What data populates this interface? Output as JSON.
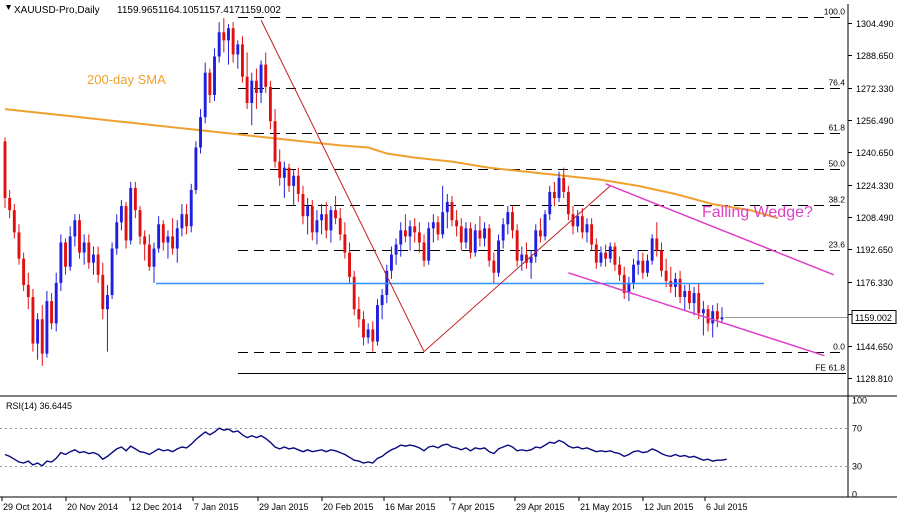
{
  "header": {
    "symbol": "XAUUSD-Pro,Daily",
    "open": "1159.965",
    "high": "1164.105",
    "low": "1157.417",
    "close": "1159.002"
  },
  "colors": {
    "bull": "#1f1fe0",
    "bear": "#e01010",
    "sma": "#f0a030",
    "wedge": "#e040c8",
    "support": "#3090ff",
    "fib": "#000000",
    "rsi": "#0a0a80",
    "zigzag": "#c02020"
  },
  "labels": {
    "sma": "200-day SMA",
    "pattern": "Falling Wedge?"
  },
  "price_axis": {
    "ticks": [
      "1304.490",
      "1288.650",
      "1272.330",
      "1256.490",
      "1240.650",
      "1224.330",
      "1208.490",
      "1192.650",
      "1176.330",
      "1160.490",
      "1144.650",
      "1128.810"
    ],
    "current": "1159.002"
  },
  "rsi": {
    "label": "RSI(14) 36.6445",
    "ticks": [
      "100",
      "70",
      "30",
      "0"
    ],
    "levels": [
      70,
      30
    ]
  },
  "x_axis": {
    "labels": [
      "29 Oct 2014",
      "20 Nov 2014",
      "12 Dec 2014",
      "7 Jan 2015",
      "29 Jan 2015",
      "20 Feb 2015",
      "16 Mar 2015",
      "7 Apr 2015",
      "29 Apr 2015",
      "21 May 2015",
      "12 Jun 2015",
      "6 Jul 2015"
    ]
  },
  "chart_data": {
    "type": "candlestick",
    "title": "XAUUSD-Pro,Daily",
    "ylim": [
      1124,
      1312
    ],
    "rsi_ylim": [
      0,
      100
    ],
    "fibonacci": [
      {
        "label": "100.0",
        "price": 1307.5
      },
      {
        "label": "76.4",
        "price": 1272.3
      },
      {
        "label": "61.8",
        "price": 1250.1
      },
      {
        "label": "50.0",
        "price": 1232.2
      },
      {
        "label": "38.2",
        "price": 1214.4
      },
      {
        "label": "23.6",
        "price": 1192.2
      },
      {
        "label": "0.0",
        "price": 1141.8
      },
      {
        "label": "FE 61.8",
        "price": 1131.5
      }
    ],
    "support_level": 1176.0,
    "sma_200": [
      [
        0,
        1262
      ],
      [
        8,
        1260
      ],
      [
        16,
        1258
      ],
      [
        24,
        1256
      ],
      [
        32,
        1254
      ],
      [
        40,
        1252
      ],
      [
        48,
        1250
      ],
      [
        56,
        1248
      ],
      [
        64,
        1246
      ],
      [
        72,
        1244
      ],
      [
        78,
        1243
      ],
      [
        82,
        1240
      ],
      [
        88,
        1238
      ],
      [
        96,
        1236
      ],
      [
        104,
        1233
      ],
      [
        112,
        1231
      ],
      [
        120,
        1229
      ],
      [
        128,
        1227
      ],
      [
        136,
        1224
      ],
      [
        144,
        1220
      ],
      [
        152,
        1215
      ],
      [
        160,
        1212
      ],
      [
        166,
        1208
      ]
    ],
    "wedge_upper": [
      [
        129,
        1225
      ],
      [
        178,
        1180
      ]
    ],
    "wedge_lower": [
      [
        121,
        1181
      ],
      [
        176,
        1140
      ]
    ],
    "zigzag": [
      [
        55,
        1306
      ],
      [
        90,
        1142
      ],
      [
        130,
        1224
      ]
    ],
    "ohlc": [
      [
        1246,
        1248,
        1213,
        1218
      ],
      [
        1218,
        1222,
        1208,
        1212
      ],
      [
        1212,
        1215,
        1198,
        1201
      ],
      [
        1201,
        1205,
        1185,
        1188
      ],
      [
        1188,
        1191,
        1172,
        1175
      ],
      [
        1175,
        1181,
        1163,
        1169
      ],
      [
        1169,
        1173,
        1142,
        1146
      ],
      [
        1146,
        1161,
        1138,
        1158
      ],
      [
        1158,
        1165,
        1135,
        1141
      ],
      [
        1141,
        1172,
        1139,
        1167
      ],
      [
        1167,
        1171,
        1153,
        1156
      ],
      [
        1156,
        1181,
        1152,
        1176
      ],
      [
        1176,
        1200,
        1172,
        1196
      ],
      [
        1196,
        1198,
        1180,
        1184
      ],
      [
        1184,
        1204,
        1182,
        1199
      ],
      [
        1199,
        1210,
        1194,
        1207
      ],
      [
        1207,
        1210,
        1188,
        1191
      ],
      [
        1191,
        1200,
        1185,
        1196
      ],
      [
        1196,
        1200,
        1183,
        1186
      ],
      [
        1186,
        1194,
        1180,
        1190
      ],
      [
        1190,
        1194,
        1176,
        1180
      ],
      [
        1180,
        1186,
        1158,
        1163
      ],
      [
        1163,
        1175,
        1142,
        1170
      ],
      [
        1170,
        1196,
        1168,
        1193
      ],
      [
        1193,
        1210,
        1190,
        1206
      ],
      [
        1206,
        1217,
        1202,
        1214
      ],
      [
        1214,
        1216,
        1193,
        1197
      ],
      [
        1197,
        1226,
        1195,
        1223
      ],
      [
        1223,
        1226,
        1208,
        1212
      ],
      [
        1212,
        1214,
        1195,
        1199
      ],
      [
        1199,
        1202,
        1187,
        1195
      ],
      [
        1195,
        1200,
        1182,
        1184
      ],
      [
        1184,
        1196,
        1176,
        1193
      ],
      [
        1193,
        1209,
        1191,
        1205
      ],
      [
        1205,
        1207,
        1192,
        1196
      ],
      [
        1196,
        1202,
        1188,
        1199
      ],
      [
        1199,
        1208,
        1190,
        1193
      ],
      [
        1193,
        1207,
        1186,
        1203
      ],
      [
        1203,
        1215,
        1199,
        1210
      ],
      [
        1210,
        1215,
        1200,
        1204
      ],
      [
        1204,
        1225,
        1201,
        1222
      ],
      [
        1222,
        1246,
        1220,
        1243
      ],
      [
        1243,
        1262,
        1240,
        1258
      ],
      [
        1258,
        1285,
        1255,
        1280
      ],
      [
        1280,
        1282,
        1265,
        1269
      ],
      [
        1269,
        1292,
        1266,
        1288
      ],
      [
        1288,
        1305,
        1285,
        1300
      ],
      [
        1300,
        1307,
        1290,
        1296
      ],
      [
        1296,
        1304,
        1284,
        1302
      ],
      [
        1302,
        1305,
        1285,
        1289
      ],
      [
        1289,
        1296,
        1282,
        1294
      ],
      [
        1294,
        1298,
        1275,
        1278
      ],
      [
        1278,
        1290,
        1262,
        1265
      ],
      [
        1265,
        1280,
        1254,
        1276
      ],
      [
        1276,
        1282,
        1262,
        1270
      ],
      [
        1270,
        1286,
        1265,
        1284
      ],
      [
        1284,
        1290,
        1270,
        1273
      ],
      [
        1273,
        1276,
        1252,
        1256
      ],
      [
        1256,
        1262,
        1233,
        1236
      ],
      [
        1236,
        1242,
        1224,
        1228
      ],
      [
        1228,
        1236,
        1218,
        1233
      ],
      [
        1233,
        1235,
        1221,
        1224
      ],
      [
        1224,
        1232,
        1214,
        1229
      ],
      [
        1229,
        1233,
        1216,
        1220
      ],
      [
        1220,
        1224,
        1205,
        1209
      ],
      [
        1209,
        1218,
        1200,
        1214
      ],
      [
        1214,
        1217,
        1197,
        1201
      ],
      [
        1201,
        1212,
        1195,
        1207
      ],
      [
        1207,
        1215,
        1200,
        1210
      ],
      [
        1210,
        1216,
        1198,
        1202
      ],
      [
        1202,
        1214,
        1196,
        1212
      ],
      [
        1212,
        1219,
        1205,
        1208
      ],
      [
        1208,
        1213,
        1197,
        1200
      ],
      [
        1200,
        1206,
        1188,
        1191
      ],
      [
        1191,
        1196,
        1176,
        1179
      ],
      [
        1179,
        1182,
        1160,
        1163
      ],
      [
        1163,
        1169,
        1154,
        1158
      ],
      [
        1158,
        1162,
        1145,
        1149
      ],
      [
        1149,
        1156,
        1146,
        1153
      ],
      [
        1153,
        1157,
        1142,
        1147
      ],
      [
        1147,
        1168,
        1145,
        1165
      ],
      [
        1165,
        1173,
        1158,
        1170
      ],
      [
        1170,
        1185,
        1166,
        1182
      ],
      [
        1182,
        1194,
        1178,
        1190
      ],
      [
        1190,
        1198,
        1185,
        1195
      ],
      [
        1195,
        1206,
        1189,
        1202
      ],
      [
        1202,
        1210,
        1196,
        1199
      ],
      [
        1199,
        1207,
        1192,
        1204
      ],
      [
        1204,
        1208,
        1196,
        1201
      ],
      [
        1201,
        1206,
        1191,
        1196
      ],
      [
        1196,
        1200,
        1184,
        1187
      ],
      [
        1187,
        1206,
        1185,
        1203
      ],
      [
        1203,
        1210,
        1196,
        1206
      ],
      [
        1206,
        1209,
        1197,
        1200
      ],
      [
        1200,
        1224,
        1198,
        1211
      ],
      [
        1211,
        1220,
        1203,
        1216
      ],
      [
        1216,
        1219,
        1204,
        1207
      ],
      [
        1207,
        1212,
        1199,
        1204
      ],
      [
        1204,
        1208,
        1192,
        1196
      ],
      [
        1196,
        1206,
        1193,
        1203
      ],
      [
        1203,
        1206,
        1188,
        1191
      ],
      [
        1191,
        1205,
        1189,
        1202
      ],
      [
        1202,
        1209,
        1194,
        1198
      ],
      [
        1198,
        1206,
        1194,
        1203
      ],
      [
        1203,
        1205,
        1184,
        1187
      ],
      [
        1187,
        1191,
        1176,
        1181
      ],
      [
        1181,
        1200,
        1179,
        1197
      ],
      [
        1197,
        1208,
        1193,
        1205
      ],
      [
        1205,
        1214,
        1200,
        1211
      ],
      [
        1211,
        1214,
        1198,
        1202
      ],
      [
        1202,
        1205,
        1184,
        1187
      ],
      [
        1187,
        1194,
        1182,
        1190
      ],
      [
        1190,
        1196,
        1183,
        1186
      ],
      [
        1186,
        1192,
        1178,
        1189
      ],
      [
        1189,
        1205,
        1186,
        1202
      ],
      [
        1202,
        1208,
        1196,
        1199
      ],
      [
        1199,
        1212,
        1197,
        1210
      ],
      [
        1210,
        1224,
        1207,
        1221
      ],
      [
        1221,
        1226,
        1214,
        1218
      ],
      [
        1218,
        1231,
        1216,
        1228
      ],
      [
        1228,
        1233,
        1218,
        1221
      ],
      [
        1221,
        1224,
        1207,
        1210
      ],
      [
        1210,
        1214,
        1200,
        1204
      ],
      [
        1204,
        1212,
        1201,
        1209
      ],
      [
        1209,
        1213,
        1198,
        1201
      ],
      [
        1201,
        1208,
        1196,
        1205
      ],
      [
        1205,
        1208,
        1192,
        1195
      ],
      [
        1195,
        1198,
        1183,
        1186
      ],
      [
        1186,
        1194,
        1184,
        1191
      ],
      [
        1191,
        1195,
        1184,
        1188
      ],
      [
        1188,
        1196,
        1186,
        1194
      ],
      [
        1194,
        1196,
        1182,
        1185
      ],
      [
        1185,
        1189,
        1177,
        1180
      ],
      [
        1180,
        1184,
        1168,
        1171
      ],
      [
        1171,
        1179,
        1167,
        1176
      ],
      [
        1176,
        1188,
        1173,
        1185
      ],
      [
        1185,
        1192,
        1180,
        1187
      ],
      [
        1187,
        1191,
        1178,
        1181
      ],
      [
        1181,
        1190,
        1179,
        1187
      ],
      [
        1187,
        1200,
        1185,
        1198
      ],
      [
        1198,
        1206,
        1189,
        1192
      ],
      [
        1192,
        1196,
        1179,
        1182
      ],
      [
        1182,
        1188,
        1174,
        1177
      ],
      [
        1177,
        1184,
        1171,
        1174
      ],
      [
        1174,
        1181,
        1169,
        1178
      ],
      [
        1178,
        1182,
        1166,
        1169
      ],
      [
        1169,
        1175,
        1162,
        1172
      ],
      [
        1172,
        1176,
        1163,
        1166
      ],
      [
        1166,
        1174,
        1160,
        1171
      ],
      [
        1171,
        1176,
        1158,
        1161
      ],
      [
        1161,
        1167,
        1150,
        1163
      ],
      [
        1163,
        1165,
        1152,
        1156
      ],
      [
        1156,
        1165,
        1149,
        1162
      ],
      [
        1162,
        1166,
        1154,
        1158
      ],
      [
        1158,
        1164,
        1156,
        1159
      ]
    ],
    "rsi_values": [
      42,
      40,
      37,
      34,
      33,
      35,
      31,
      33,
      30,
      35,
      34,
      38,
      44,
      42,
      45,
      47,
      44,
      45,
      43,
      44,
      42,
      37,
      40,
      44,
      48,
      50,
      46,
      51,
      48,
      45,
      44,
      42,
      45,
      48,
      46,
      47,
      45,
      48,
      50,
      49,
      53,
      58,
      62,
      66,
      63,
      66,
      70,
      68,
      69,
      66,
      67,
      63,
      60,
      62,
      60,
      62,
      59,
      55,
      50,
      48,
      50,
      48,
      49,
      47,
      45,
      47,
      45,
      46,
      47,
      45,
      47,
      46,
      44,
      42,
      39,
      36,
      35,
      33,
      34,
      33,
      38,
      40,
      44,
      47,
      49,
      52,
      51,
      52,
      51,
      49,
      46,
      50,
      51,
      49,
      52,
      53,
      50,
      49,
      47,
      49,
      46,
      49,
      48,
      49,
      45,
      43,
      48,
      50,
      52,
      50,
      46,
      47,
      46,
      47,
      50,
      49,
      52,
      55,
      54,
      57,
      55,
      51,
      49,
      50,
      48,
      49,
      47,
      45,
      46,
      45,
      46,
      44,
      43,
      40,
      42,
      45,
      46,
      44,
      45,
      48,
      46,
      43,
      41,
      40,
      42,
      40,
      41,
      39,
      40,
      38,
      36,
      37,
      35,
      36,
      36,
      37
    ]
  }
}
